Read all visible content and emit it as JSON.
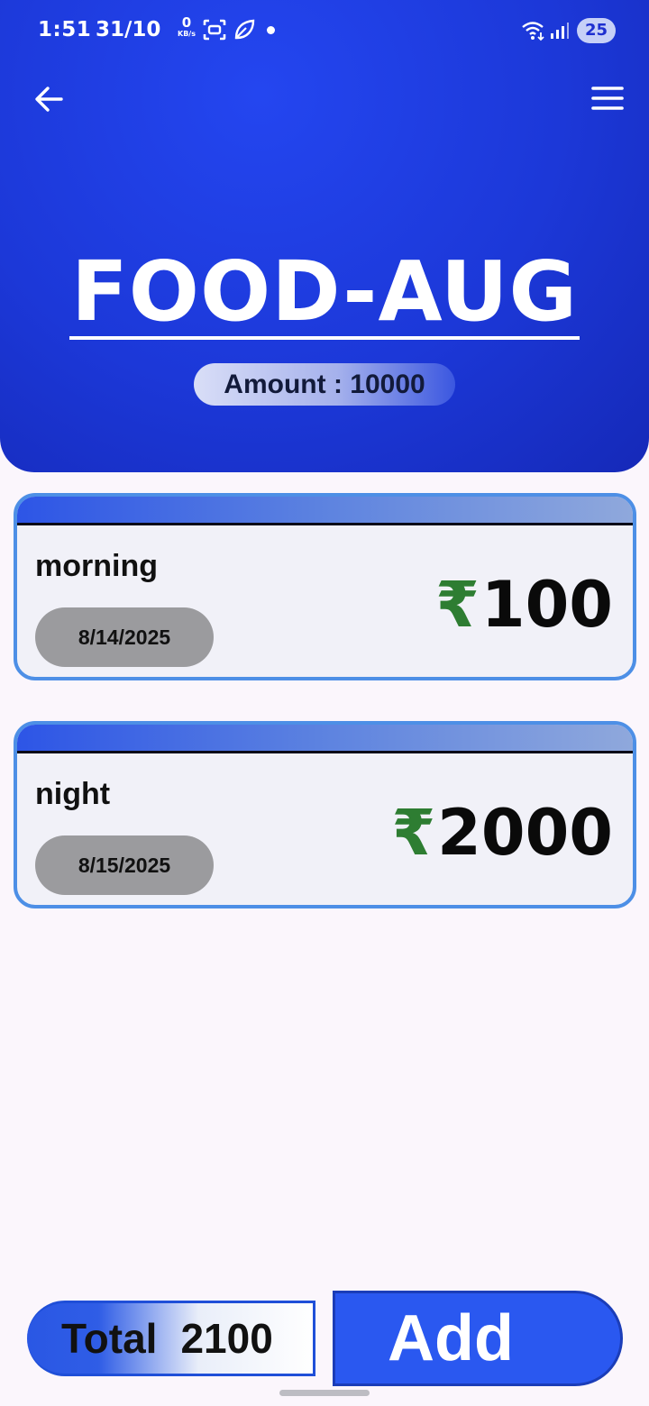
{
  "status_bar": {
    "time": "1:51",
    "date": "31/10",
    "net_speed_value": "0",
    "net_speed_unit": "KB/s",
    "battery": "25"
  },
  "header": {
    "title": "FOOD-AUG",
    "amount_text": "Amount : 10000",
    "color": "#1c38d8"
  },
  "expenses": [
    {
      "label": "morning",
      "date": "8/14/2025",
      "currency": "₹",
      "amount": "100"
    },
    {
      "label": "night",
      "date": "8/15/2025",
      "currency": "₹",
      "amount": "2000"
    }
  ],
  "footer": {
    "total_label": "Total",
    "total_value": "2100",
    "add_label": "Add"
  },
  "colors": {
    "accent": "#2a58f0",
    "rupee": "#2e7d32",
    "card_border": "#4d8fe6",
    "date_pill": "#9b9b9e"
  },
  "icons": {
    "back": "arrow-left-icon",
    "menu": "hamburger-menu-icon"
  }
}
